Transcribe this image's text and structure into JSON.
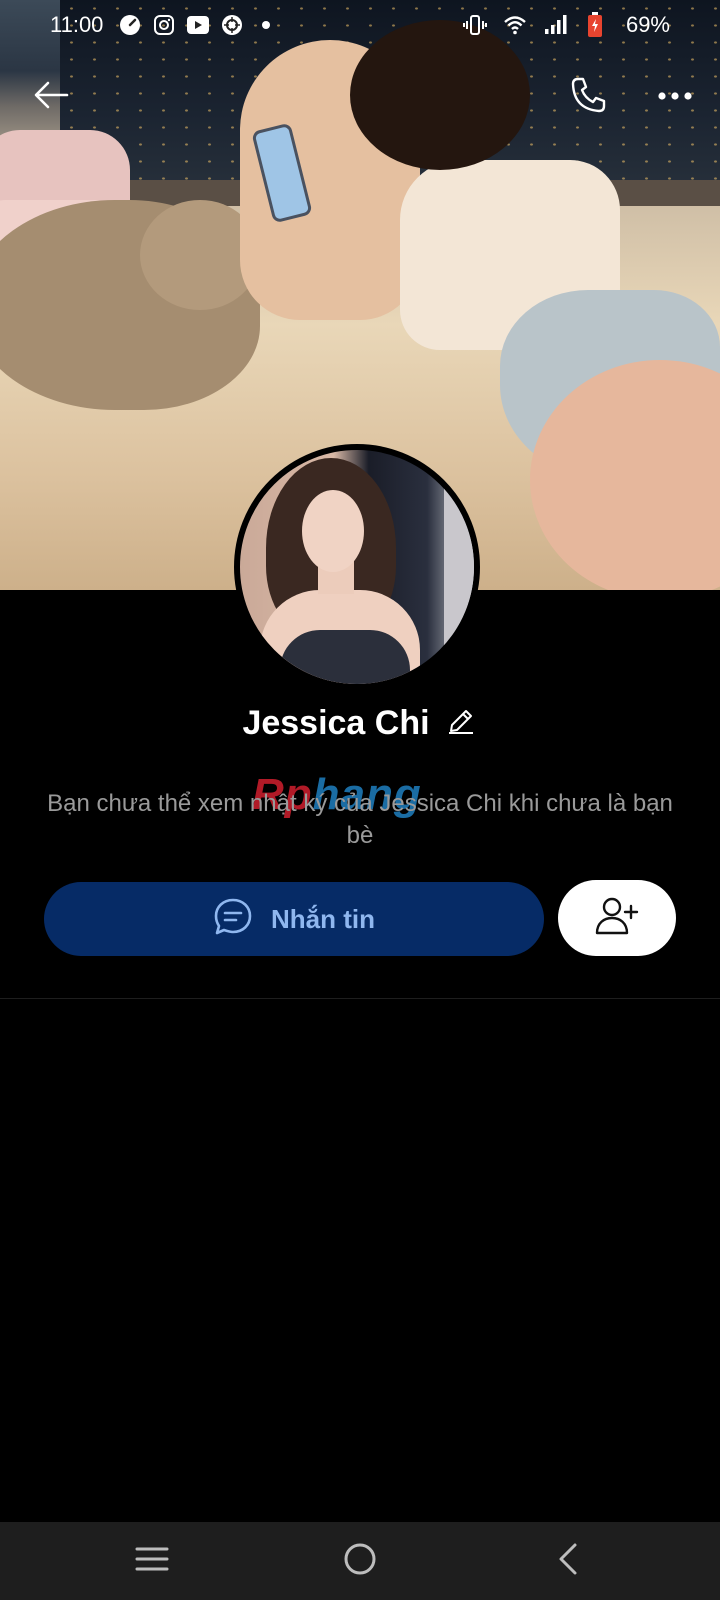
{
  "status_bar": {
    "time": "11:00",
    "battery": "69%",
    "icons": [
      "speedometer-app-icon",
      "instagram-icon",
      "video-app-icon",
      "app-icon",
      "notification-dot-icon",
      "vibrate-icon",
      "wifi-icon",
      "signal-icon",
      "battery-icon"
    ]
  },
  "top_bar": {
    "icons": [
      "back-arrow-icon",
      "phone-call-icon",
      "more-icon"
    ]
  },
  "profile": {
    "name": "Jessica Chi",
    "info": "Bạn chưa thể xem nhật ký của Jessica Chi khi chưa là bạn bè",
    "watermark_part1": "Rp",
    "watermark_part2": "hang"
  },
  "actions": {
    "message_label": "Nhắn tin"
  },
  "colors": {
    "message_button_bg": "#062b66",
    "message_label": "#8fb7ef",
    "background": "#000000",
    "nav_bar": "#1e1e1e"
  },
  "nav_bar": {
    "icons": [
      "recent-apps-icon",
      "home-icon",
      "back-icon"
    ]
  }
}
